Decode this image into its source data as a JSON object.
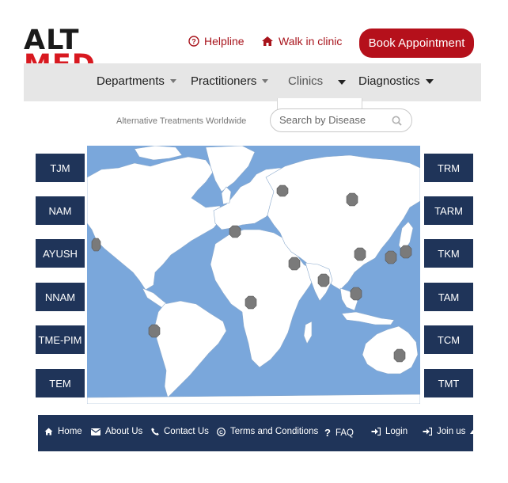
{
  "logo": {
    "line1": "ALT",
    "line2": "MED"
  },
  "topbar": {
    "helpline": "Helpline",
    "walk_in": "Walk in clinic",
    "book": "Book Appointment"
  },
  "nav": {
    "departments": "Departments",
    "practitioners": "Practitioners",
    "clinics": "Clinics",
    "diagnostics": "Diagnostics"
  },
  "search": {
    "tagline": "Alternative Treatments Worldwide",
    "placeholder": "Search by Disease"
  },
  "left_buttons": [
    "TJM",
    "NAM",
    "AYUSH",
    "NNAM",
    "TME-PIM",
    "TEM"
  ],
  "right_buttons": [
    "TRM",
    "TARM",
    "TKM",
    "TAM",
    "TCM",
    "TMT"
  ],
  "footer": {
    "home": "Home",
    "about": "About Us",
    "contact": "Contact Us",
    "terms": "Terms and Conditions",
    "faq": "FAQ",
    "login": "Login",
    "join": "Join us"
  },
  "colors": {
    "brand_red": "#b5101b",
    "navy": "#1f3459",
    "map_ocean": "#7aa7db",
    "map_land": "#ffffff",
    "marker": "#7a7a7a"
  },
  "icons": [
    "question-circle-icon",
    "home-icon",
    "search-icon",
    "envelope-icon",
    "phone-icon",
    "copyright-icon",
    "question-icon",
    "sign-in-icon",
    "caret-up-icon"
  ]
}
